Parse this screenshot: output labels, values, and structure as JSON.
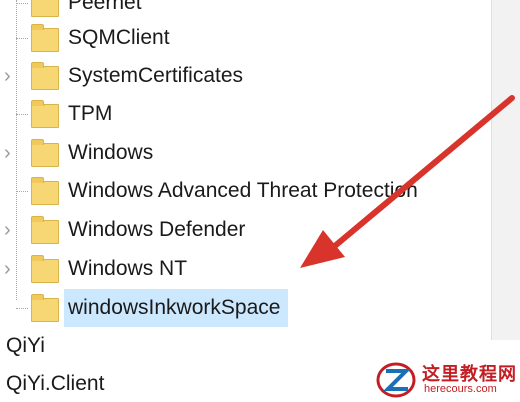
{
  "tree": {
    "items": [
      {
        "label": "Peernet",
        "expandable": false
      },
      {
        "label": "SQMClient",
        "expandable": false
      },
      {
        "label": "SystemCertificates",
        "expandable": true
      },
      {
        "label": "TPM",
        "expandable": false
      },
      {
        "label": "Windows",
        "expandable": true
      },
      {
        "label": "Windows Advanced Threat Protection",
        "expandable": false
      },
      {
        "label": "Windows Defender",
        "expandable": true
      },
      {
        "label": "Windows NT",
        "expandable": true
      },
      {
        "label": "windowsInkworkSpace",
        "expandable": false,
        "selected": true
      }
    ],
    "root_items": [
      "QiYi",
      "QiYi.Client"
    ]
  },
  "colors": {
    "folder": "#f7d774",
    "selected": "#cce8ff",
    "arrow": "#d9342c",
    "watermark": "#c21f24"
  },
  "watermark": {
    "title": "这里教程网",
    "url": "herecours.com"
  }
}
